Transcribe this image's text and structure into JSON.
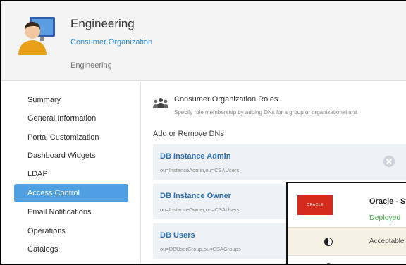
{
  "header": {
    "title": "Engineering",
    "org_link": "Consumer Organization",
    "subtitle": "Engineering"
  },
  "sidebar": {
    "items": [
      {
        "label": "Summary",
        "active": false
      },
      {
        "label": "General Information",
        "active": false
      },
      {
        "label": "Portal Customization",
        "active": false
      },
      {
        "label": "Dashboard Widgets",
        "active": false
      },
      {
        "label": "LDAP",
        "active": false
      },
      {
        "label": "Access Control",
        "active": true
      },
      {
        "label": "Email Notifications",
        "active": false
      },
      {
        "label": "Operations",
        "active": false
      },
      {
        "label": "Catalogs",
        "active": false
      }
    ],
    "active_color": "#4f9fe3"
  },
  "main": {
    "roles_title": "Consumer Organization Roles",
    "roles_desc": "Specify role membership by adding DNs for a group or organizational unit",
    "add_remove_label": "Add or Remove DNs",
    "dns": [
      {
        "name": "DB Instance Admin",
        "path": "ou=InstanceAdmin,ou=CSAUsers"
      },
      {
        "name": "DB Instance Owner",
        "path": "ou=InstanceOwner,ou=CSAUsers"
      },
      {
        "name": "DB Users",
        "path": "ou=DBUserGroup,ou=CSAGroups"
      }
    ]
  },
  "overlay": {
    "logo_text": "ORACLE",
    "title": "Oracle - Sta",
    "status": "Deployed",
    "row_label": "Acceptable",
    "status_color": "#4caf50",
    "logo_color": "#d52b1e"
  },
  "icons": {
    "avatar": "user-avatar-icon",
    "roles": "group-users-icon",
    "remove": "close-circle-icon",
    "half": "half-circle-icon"
  }
}
